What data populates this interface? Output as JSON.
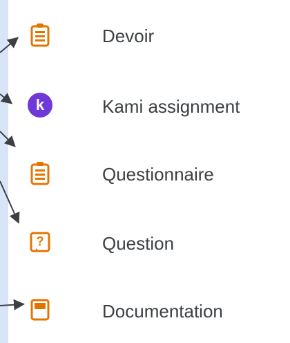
{
  "menu": {
    "items": [
      {
        "label": "Devoir",
        "icon": "assignment-icon",
        "color": "#e37400"
      },
      {
        "label": "Kami assignment",
        "icon": "kami-logo-icon",
        "color": "#6f38d8"
      },
      {
        "label": "Questionnaire",
        "icon": "quiz-assignment-icon",
        "color": "#e37400"
      },
      {
        "label": "Question",
        "icon": "question-icon",
        "color": "#e37400"
      },
      {
        "label": "Documentation",
        "icon": "material-icon",
        "color": "#e37400"
      }
    ]
  },
  "colors": {
    "background": "#d8e4f7",
    "panel": "#ffffff",
    "text": "#3c4043",
    "accent_orange": "#e37400",
    "accent_purple": "#6f38d8"
  }
}
